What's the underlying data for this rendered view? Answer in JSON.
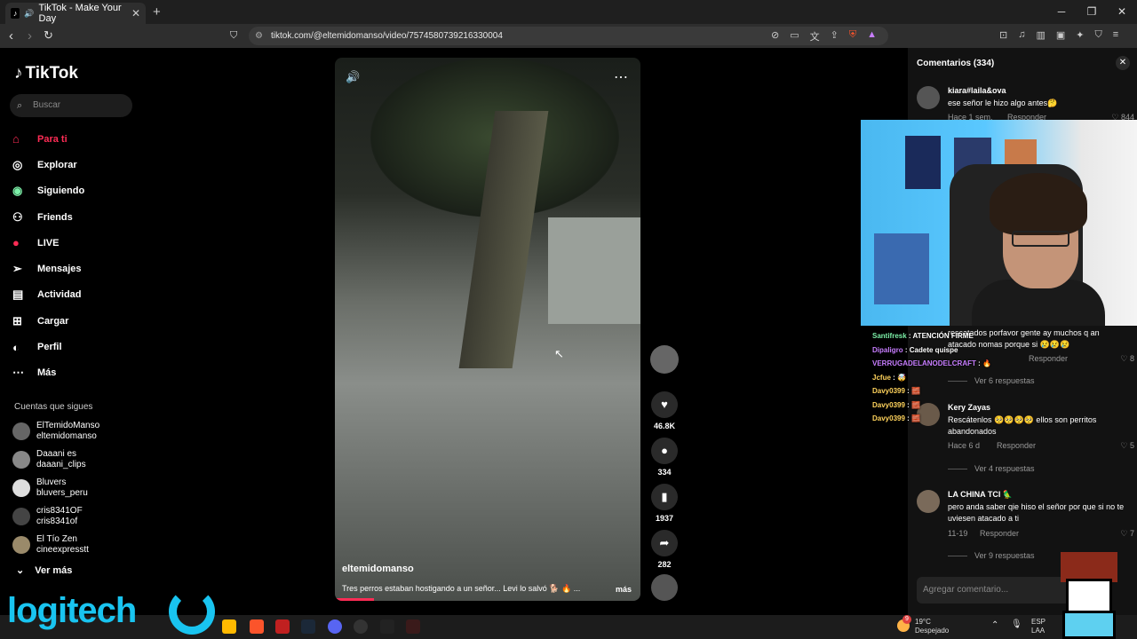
{
  "browser": {
    "tab_title": "TikTok - Make Your Day",
    "url": "tiktok.com/@eltemidomanso/video/7574580739216330004"
  },
  "sidebar": {
    "logo": "TikTok",
    "search_placeholder": "Buscar",
    "menu": [
      {
        "label": "Para ti",
        "icon": "home-icon"
      },
      {
        "label": "Explorar",
        "icon": "compass-icon"
      },
      {
        "label": "Siguiendo",
        "icon": "following-icon"
      },
      {
        "label": "Friends",
        "icon": "friends-icon"
      },
      {
        "label": "LIVE",
        "icon": "live-icon"
      },
      {
        "label": "Mensajes",
        "icon": "messages-icon"
      },
      {
        "label": "Actividad",
        "icon": "activity-icon"
      },
      {
        "label": "Cargar",
        "icon": "upload-icon"
      },
      {
        "label": "Perfil",
        "icon": "profile-icon"
      },
      {
        "label": "Más",
        "icon": "more-icon"
      }
    ],
    "following_header": "Cuentas que sigues",
    "accounts": [
      {
        "name": "ElTemidoManso",
        "handle": "eltemidomanso"
      },
      {
        "name": "Daaani es",
        "handle": "daaani_clips"
      },
      {
        "name": "Bluvers",
        "handle": "bluvers_peru"
      },
      {
        "name": "cris8341OF",
        "handle": "cris8341of"
      },
      {
        "name": "El Tío Zen",
        "handle": "cineexpresstt"
      }
    ],
    "see_more": "Ver más"
  },
  "video": {
    "username": "eltemidomanso",
    "caption": "Tres perros estaban hostigando a un señor... Levi lo salvó 🐕 🔥 ...",
    "more": "más",
    "likes": "46.8K",
    "comments": "334",
    "saves": "1937",
    "shares": "282"
  },
  "comments_panel": {
    "title": "Comentarios (334)",
    "add_placeholder": "Agregar comentario...",
    "items": [
      {
        "user": "kiara#laila&ova",
        "text": "ese señor le hizo algo antes🤔",
        "meta": "Hace 1 sem.",
        "reply": "Responder",
        "likes": "844"
      },
      {
        "user": "",
        "text": "rescatados porfavor gente ay muchos q an atacado nomas porque si 😢😢😢",
        "meta": "",
        "reply": "Responder",
        "likes": "8"
      },
      {
        "user": "Kery Zayas",
        "text": "Rescátenlos 🥺🥺🥺🥺 ellos son perritos abandonados",
        "meta": "Hace 6 d",
        "reply": "Responder",
        "likes": "5"
      },
      {
        "user": "LA CHINA TCI 🦜",
        "text": "pero anda saber qie hiso el señor por que si no te uviesen atacado a ti",
        "meta": "11-19",
        "reply": "Responder",
        "likes": "7"
      }
    ],
    "view_replies": [
      "Ver 6 respuestas",
      "Ver 4 respuestas",
      "Ver 9 respuestas"
    ]
  },
  "stream_chat": [
    {
      "user": "Santifresk",
      "msg": "ATENCIÓN FIRME",
      "color": "#7cf0a8"
    },
    {
      "user": "Dipaligro",
      "msg": "Cadete quispe",
      "color": "#c77dff"
    },
    {
      "user": "VERRUGADELANODELCRAFT",
      "msg": "🔥",
      "color": "#c77dff"
    },
    {
      "user": "Jcfue",
      "msg": "🤯",
      "color": "#ffd35c"
    },
    {
      "user": "Davy0399",
      "msg": "🧱",
      "color": "#ffd35c"
    },
    {
      "user": "Davy0399",
      "msg": "🧱",
      "color": "#ffd35c"
    },
    {
      "user": "Davy0399",
      "msg": "🧱",
      "color": "#ffd35c"
    }
  ],
  "taskbar": {
    "weather_temp": "19°C",
    "weather_desc": "Despejado",
    "lang": "ESP",
    "lang2": "LAA",
    "notif": "9"
  },
  "overlay": {
    "brand": "logitech"
  },
  "colors": {
    "accent": "#fe2c55",
    "brand": "#19c4f0"
  }
}
